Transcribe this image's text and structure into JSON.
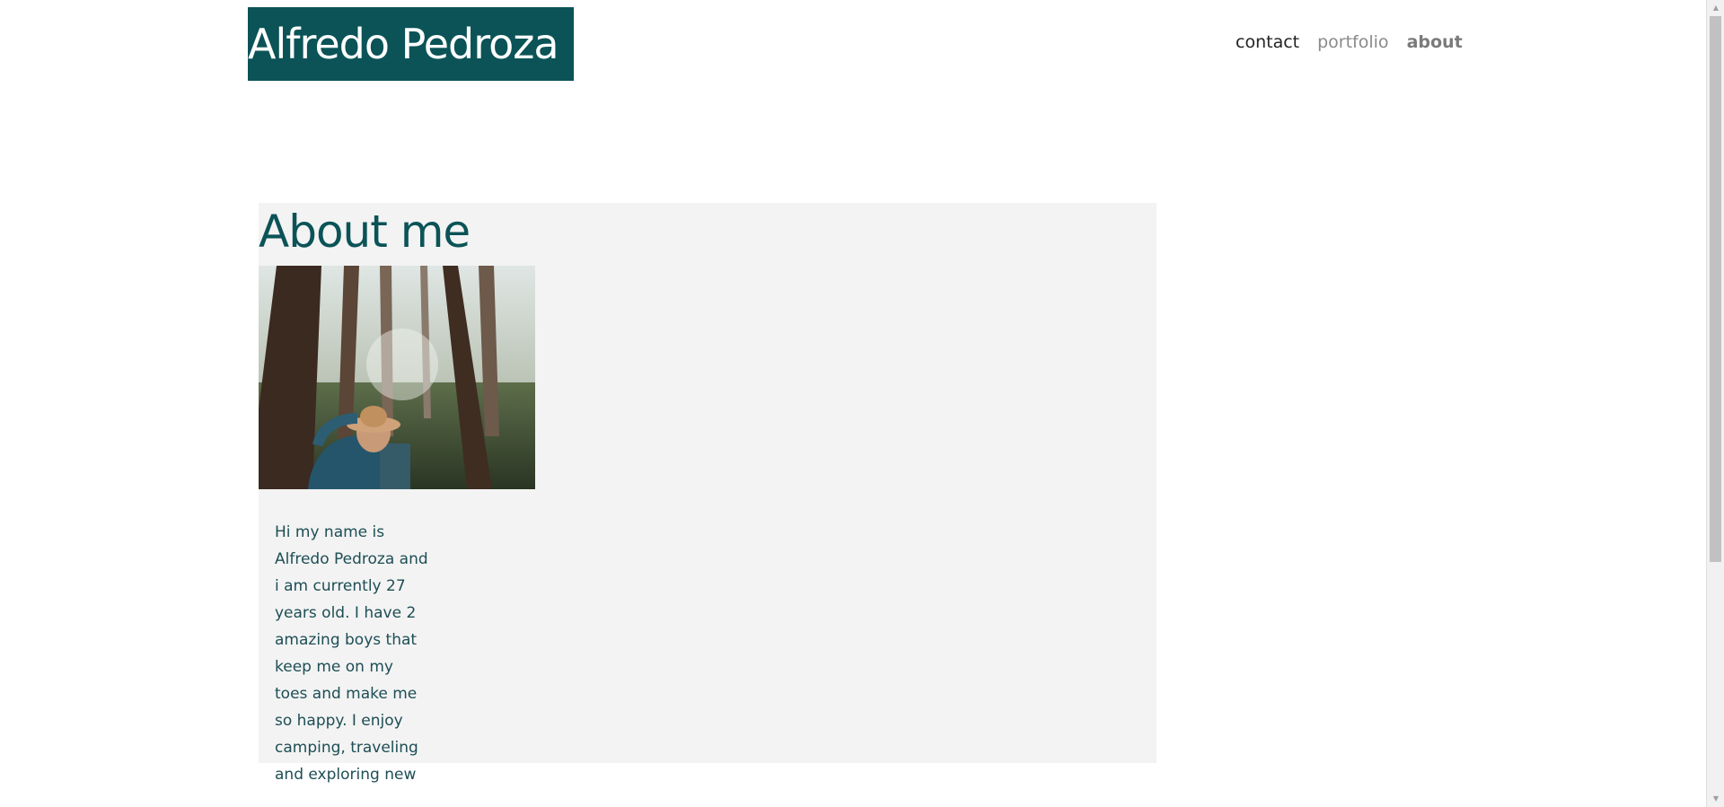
{
  "header": {
    "logo_text": "Alfredo Pedroza",
    "nav": {
      "contact": "contact",
      "portfolio": "portfolio",
      "about": "about"
    }
  },
  "about": {
    "title": "About me",
    "photo_alt": "Person wearing a hat in a forest",
    "bio": "Hi my name is Alfredo Pedroza and i am currently 27 years old. I have 2 amazing boys that keep me on my toes and make me so happy. I enjoy camping, traveling and exploring new"
  },
  "colors": {
    "brand": "#0b5357",
    "panel": "#f3f3f3",
    "nav_active": "#222222",
    "nav_muted": "#8a8a8a"
  }
}
